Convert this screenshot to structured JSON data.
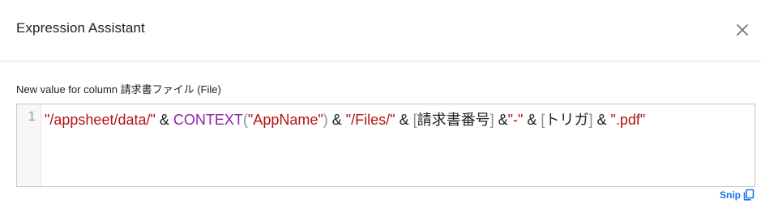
{
  "dialog": {
    "title": "Expression Assistant",
    "close_icon": "close-icon"
  },
  "field": {
    "label": "New value for column 請求書ファイル (File)"
  },
  "editor": {
    "line_number": "1",
    "tokens": [
      {
        "type": "str",
        "text": "\"/appsheet/data/\""
      },
      {
        "type": "op",
        "text": " & "
      },
      {
        "type": "func",
        "text": "CONTEXT"
      },
      {
        "type": "paren",
        "text": "("
      },
      {
        "type": "str",
        "text": "\"AppName\""
      },
      {
        "type": "paren",
        "text": ")"
      },
      {
        "type": "op",
        "text": " & "
      },
      {
        "type": "str",
        "text": "\"/Files/\""
      },
      {
        "type": "op",
        "text": " & "
      },
      {
        "type": "bracket",
        "text": "["
      },
      {
        "type": "col",
        "text": "請求書番号"
      },
      {
        "type": "bracket",
        "text": "]"
      },
      {
        "type": "op",
        "text": " &"
      },
      {
        "type": "str",
        "text": "\"-\""
      },
      {
        "type": "op",
        "text": " & "
      },
      {
        "type": "bracket",
        "text": "["
      },
      {
        "type": "col",
        "text": "トリガ"
      },
      {
        "type": "bracket",
        "text": "]"
      },
      {
        "type": "op",
        "text": " & "
      },
      {
        "type": "str",
        "text": "\".pdf\""
      }
    ]
  },
  "snip": {
    "label": "Snip",
    "icon": "copy-icon"
  },
  "colors": {
    "string": "#b31412",
    "function": "#8e24aa",
    "bracket": "#8e8e8e",
    "link": "#1a73e8"
  }
}
